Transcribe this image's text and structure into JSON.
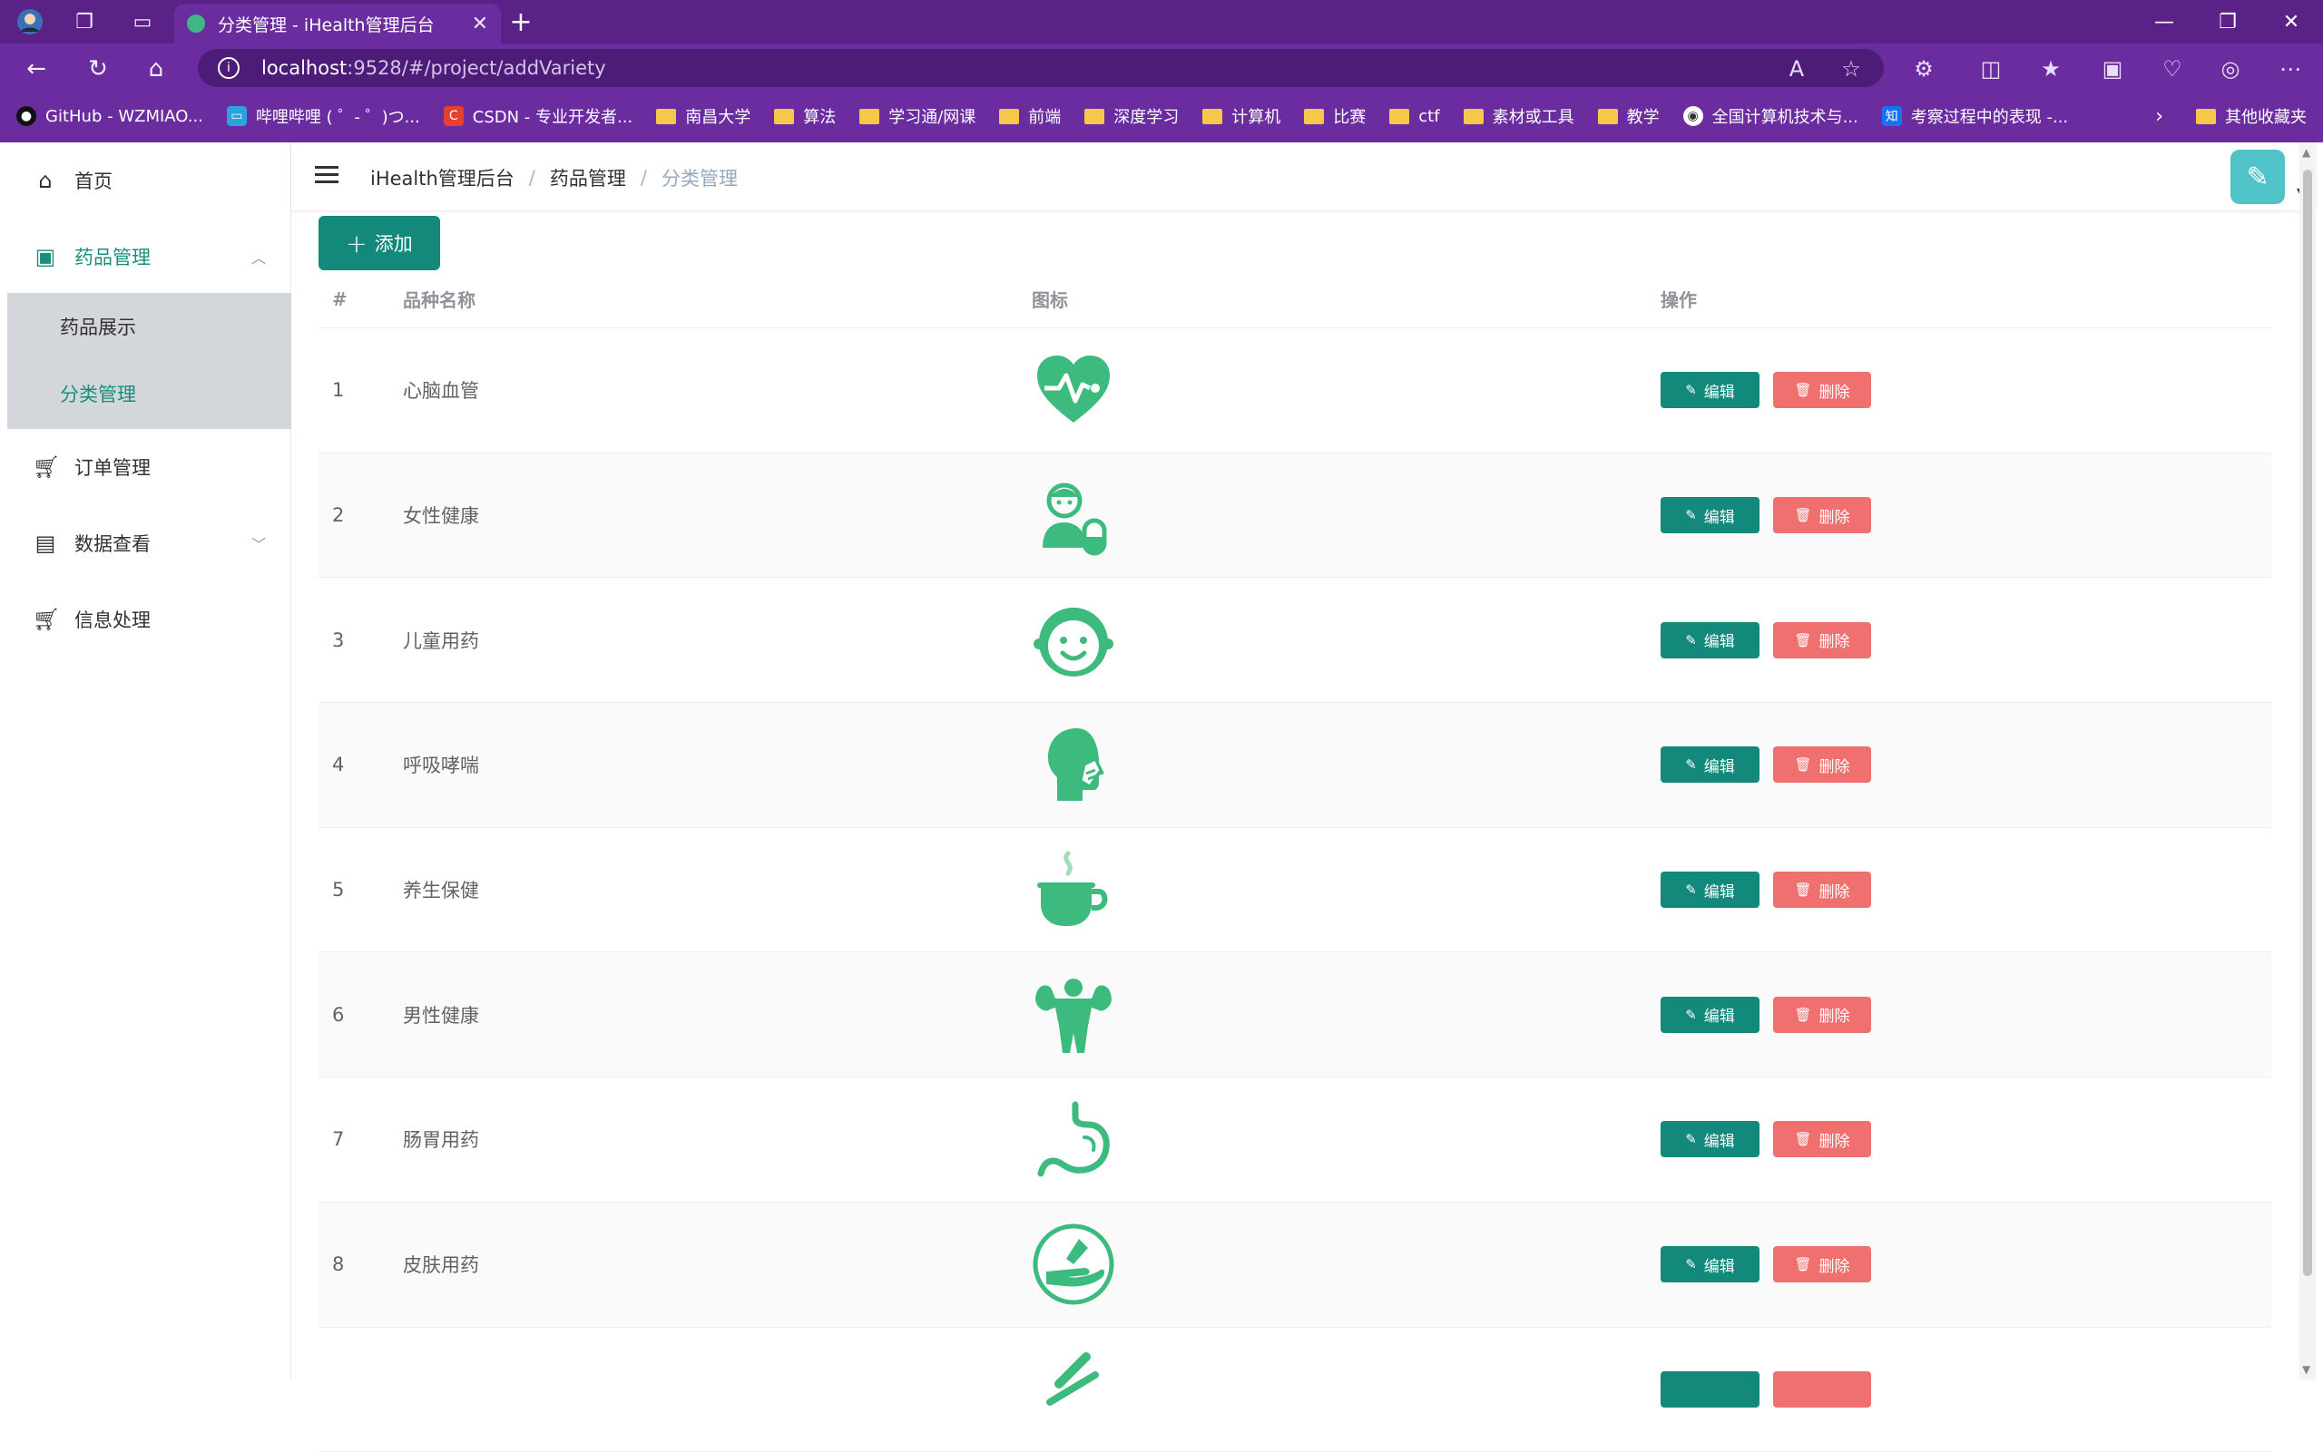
{
  "browser": {
    "tab_title": "分类管理 - iHealth管理后台",
    "url_host": "localhost",
    "url_path": ":9528/#/project/addVariety",
    "bookmarks": [
      "GitHub - WZMIAO...",
      "哔哩哔哩 ( ゜- ゜)つ...",
      "CSDN - 专业开发者...",
      "南昌大学",
      "算法",
      "学习通/网课",
      "前端",
      "深度学习",
      "计算机",
      "比赛",
      "ctf",
      "素材或工具",
      "教学",
      "全国计算机技术与...",
      "考察过程中的表现 -..."
    ],
    "other_bookmarks": "其他收藏夹"
  },
  "sidebar": {
    "items": [
      {
        "label": "首页",
        "icon": "home-icon"
      },
      {
        "label": "药品管理",
        "icon": "medicine-bag-icon"
      },
      {
        "label": "订单管理",
        "icon": "cart-icon"
      },
      {
        "label": "数据查看",
        "icon": "chart-board-icon"
      },
      {
        "label": "信息处理",
        "icon": "cart-icon"
      }
    ],
    "sub_items": [
      {
        "label": "药品展示"
      },
      {
        "label": "分类管理"
      }
    ]
  },
  "header": {
    "breadcrumb": [
      "iHealth管理后台",
      "药品管理",
      "分类管理"
    ]
  },
  "toolbar": {
    "add_label": "添加"
  },
  "table": {
    "columns": [
      "#",
      "品种名称",
      "图标",
      "操作"
    ],
    "edit_label": "编辑",
    "delete_label": "删除",
    "rows": [
      {
        "index": "1",
        "name": "心脑血管",
        "icon": "heart-pulse-icon"
      },
      {
        "index": "2",
        "name": "女性健康",
        "icon": "woman-pill-icon"
      },
      {
        "index": "3",
        "name": "儿童用药",
        "icon": "child-face-icon"
      },
      {
        "index": "4",
        "name": "呼吸哮喘",
        "icon": "cough-head-icon"
      },
      {
        "index": "5",
        "name": "养生保健",
        "icon": "tea-cup-icon"
      },
      {
        "index": "6",
        "name": "男性健康",
        "icon": "muscle-man-icon"
      },
      {
        "index": "7",
        "name": "肠胃用药",
        "icon": "stomach-icon"
      },
      {
        "index": "8",
        "name": "皮肤用药",
        "icon": "skin-cream-icon"
      }
    ]
  },
  "colors": {
    "accent": "#12897a",
    "danger": "#f07070",
    "icon_green": "#3dbb7e",
    "browser_purple": "#6b2ca0"
  }
}
